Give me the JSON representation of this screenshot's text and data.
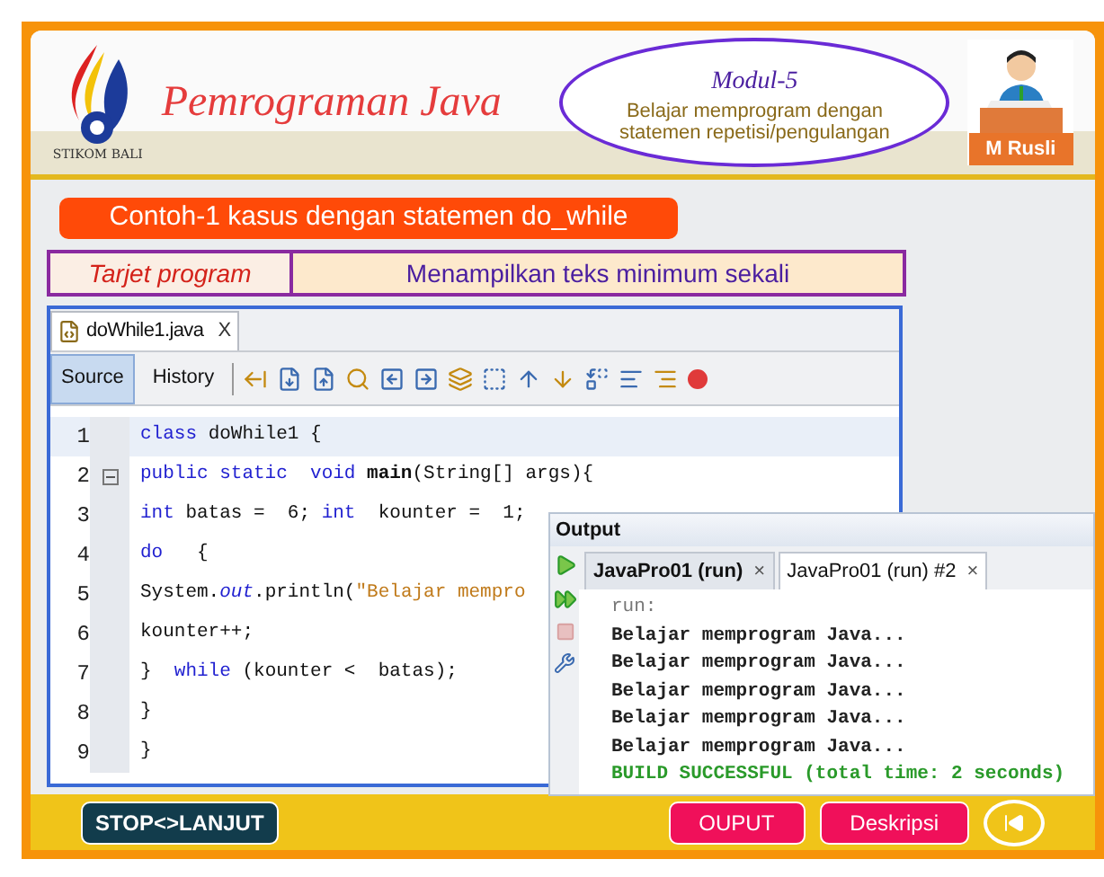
{
  "header": {
    "logo_text": "STIKOM BALI",
    "title": "Pemrograman Java",
    "module": {
      "title": "Modul-5",
      "subtitle": "Belajar memprogram dengan statemen repetisi/pengulangan"
    },
    "author": "M Rusli"
  },
  "banner": "Contoh-1 kasus dengan statemen do_while",
  "target": {
    "label": "Tarjet program",
    "value": "Menampilkan teks minimum sekali"
  },
  "editor": {
    "file_tab": {
      "label": "doWhile1.java",
      "close": "X"
    },
    "view_tabs": [
      {
        "label": "Source",
        "selected": true
      },
      {
        "label": "History",
        "selected": false
      }
    ],
    "lines": [
      {
        "number": "1",
        "fold": false,
        "tokens": [
          {
            "kind": "keyword",
            "text": "class"
          },
          {
            "kind": "plain",
            "text": " doWhile1 {"
          }
        ]
      },
      {
        "number": "2",
        "fold": true,
        "tokens": [
          {
            "kind": "keyword",
            "text": "public static  void "
          },
          {
            "kind": "method",
            "text": "main"
          },
          {
            "kind": "plain",
            "text": "(String[] args){"
          }
        ]
      },
      {
        "number": "3",
        "fold": false,
        "tokens": [
          {
            "kind": "keyword",
            "text": "int"
          },
          {
            "kind": "plain",
            "text": " batas =  6; "
          },
          {
            "kind": "keyword",
            "text": "int"
          },
          {
            "kind": "plain",
            "text": "  kounter =  1;"
          }
        ]
      },
      {
        "number": "4",
        "fold": false,
        "tokens": [
          {
            "kind": "keyword",
            "text": "do"
          },
          {
            "kind": "plain",
            "text": "   {"
          }
        ]
      },
      {
        "number": "5",
        "fold": false,
        "tokens": [
          {
            "kind": "plain",
            "text": "System."
          },
          {
            "kind": "field",
            "text": "out"
          },
          {
            "kind": "plain",
            "text": ".println("
          },
          {
            "kind": "string",
            "text": "\"Belajar mempro"
          }
        ]
      },
      {
        "number": "6",
        "fold": false,
        "tokens": [
          {
            "kind": "plain",
            "text": "kounter++;"
          }
        ]
      },
      {
        "number": "7",
        "fold": false,
        "tokens": [
          {
            "kind": "plain",
            "text": "}  "
          },
          {
            "kind": "keyword",
            "text": "while"
          },
          {
            "kind": "plain",
            "text": " (kounter <  batas);"
          }
        ]
      },
      {
        "number": "8",
        "fold": false,
        "tokens": [
          {
            "kind": "plain",
            "text": "}"
          }
        ]
      },
      {
        "number": "9",
        "fold": false,
        "tokens": [
          {
            "kind": "plain",
            "text": "}"
          }
        ]
      }
    ]
  },
  "output": {
    "title": "Output",
    "tabs": [
      {
        "label": "JavaPro01 (run)",
        "close": "×",
        "selected": false
      },
      {
        "label": "JavaPro01 (run) #2",
        "close": "×",
        "selected": true
      }
    ],
    "lines": [
      {
        "kind": "info",
        "text": "run:"
      },
      {
        "kind": "plain",
        "text": "Belajar memprogram Java..."
      },
      {
        "kind": "plain",
        "text": "Belajar memprogram Java..."
      },
      {
        "kind": "plain",
        "text": "Belajar memprogram Java..."
      },
      {
        "kind": "plain",
        "text": "Belajar memprogram Java..."
      },
      {
        "kind": "plain",
        "text": "Belajar memprogram Java..."
      },
      {
        "kind": "success",
        "text": "BUILD SUCCESSFUL (total time: 2 seconds)"
      }
    ]
  },
  "footer": {
    "stop_button": "STOP<>LANJUT",
    "buttons": [
      "OUPUT",
      "Deskripsi"
    ]
  }
}
